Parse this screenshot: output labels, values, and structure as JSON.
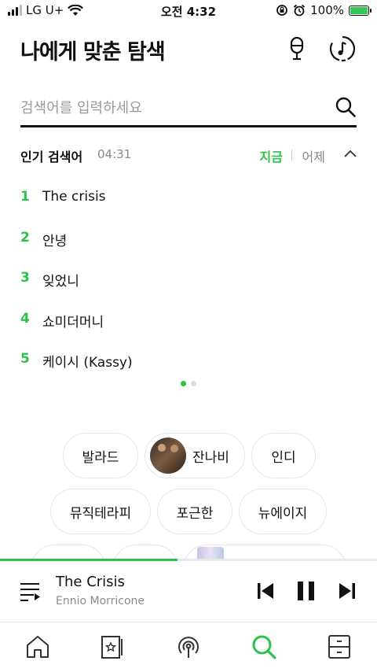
{
  "status_bar": {
    "carrier": "LG U+",
    "time": "오전 4:32",
    "battery": "100%",
    "battery_level": 1.0
  },
  "header": {
    "title": "나에게 맞춘 탐색",
    "icons": [
      "microphone-icon",
      "music-recognition-icon"
    ]
  },
  "search": {
    "placeholder": "검색어를 입력하세요",
    "value": ""
  },
  "popular": {
    "title": "인기 검색어",
    "time": "04:31",
    "tab_now": "지금",
    "tab_yesterday": "어제",
    "items": [
      {
        "rank": "1",
        "text": "The crisis"
      },
      {
        "rank": "2",
        "text": "안녕"
      },
      {
        "rank": "3",
        "text": "잊었니"
      },
      {
        "rank": "4",
        "text": "쇼미더머니"
      },
      {
        "rank": "5",
        "text": "케이시 (Kassy)"
      }
    ],
    "page_count": 2,
    "active_page": 1
  },
  "chips": [
    {
      "label": "발라드"
    },
    {
      "label": "잔나비"
    },
    {
      "label": "인디"
    },
    {
      "label": "뮤직테라피"
    },
    {
      "label": "포근한"
    },
    {
      "label": "뉴에이지"
    }
  ],
  "player": {
    "title": "The Crisis",
    "artist": "Ennio Morricone",
    "progress": 0.47
  },
  "tabbar": {
    "items": [
      "home-icon",
      "library-icon",
      "podcast-icon",
      "search-icon",
      "storage-icon"
    ],
    "active": "search-icon"
  },
  "colors": {
    "accent": "#2bc24b",
    "text": "#111111",
    "muted": "#888888",
    "border": "#e6e6e6"
  }
}
